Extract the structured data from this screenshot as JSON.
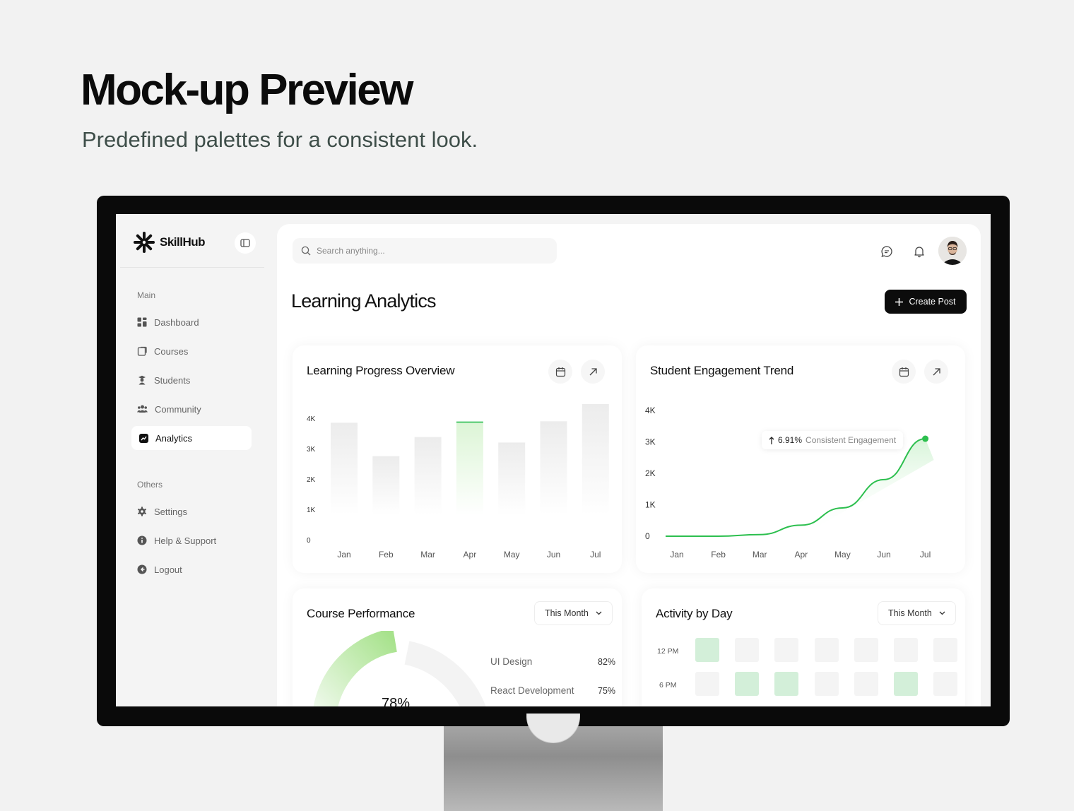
{
  "hero": {
    "title": "Mock-up Preview",
    "subtitle": "Predefined palettes for a consistent look."
  },
  "brand": {
    "name": "SkillHub"
  },
  "sidebar": {
    "main_label": "Main",
    "others_label": "Others",
    "main_items": [
      {
        "label": "Dashboard",
        "icon": "grid-icon"
      },
      {
        "label": "Courses",
        "icon": "book-icon"
      },
      {
        "label": "Students",
        "icon": "student-icon"
      },
      {
        "label": "Community",
        "icon": "users-icon"
      },
      {
        "label": "Analytics",
        "icon": "chart-icon",
        "active": true
      }
    ],
    "other_items": [
      {
        "label": "Settings",
        "icon": "gear-icon"
      },
      {
        "label": "Help & Support",
        "icon": "info-icon"
      },
      {
        "label": "Logout",
        "icon": "logout-icon"
      }
    ]
  },
  "search": {
    "placeholder": "Search anything..."
  },
  "page": {
    "title": "Learning Analytics",
    "create_label": "Create Post"
  },
  "progress_card": {
    "title": "Learning Progress Overview"
  },
  "engagement_card": {
    "title": "Student Engagement Trend",
    "badge_value": "6.91%",
    "badge_label": "Consistent Engagement"
  },
  "course_card": {
    "title": "Course Performance",
    "filter": "This Month",
    "gauge_value": "78%",
    "items": [
      {
        "label": "UI Design",
        "value": "82%"
      },
      {
        "label": "React Development",
        "value": "75%"
      }
    ]
  },
  "activity_card": {
    "title": "Activity by Day",
    "filter": "This Month",
    "rows": [
      {
        "label": "12 PM",
        "cells": [
          1,
          0,
          0,
          0,
          0,
          0,
          0
        ]
      },
      {
        "label": "6 PM",
        "cells": [
          0,
          1,
          1,
          0,
          0,
          1,
          0
        ]
      }
    ]
  },
  "colors": {
    "accent": "#22c55e",
    "accent_soft": "#d3efd9",
    "dark": "#0c0c0c"
  },
  "chart_data": [
    {
      "type": "bar",
      "categories": [
        "Jan",
        "Feb",
        "Mar",
        "Apr",
        "May",
        "Jun",
        "Jul"
      ],
      "values": [
        3850,
        2750,
        3380,
        3880,
        3200,
        3900,
        4500
      ],
      "highlight": "Apr",
      "ylim": [
        0,
        4000
      ],
      "yticks": [
        "0",
        "1K",
        "2K",
        "3K",
        "4K"
      ]
    },
    {
      "type": "line",
      "x": [
        "Jan",
        "Feb",
        "Mar",
        "Apr",
        "May",
        "Jun",
        "Jul"
      ],
      "values": [
        0,
        0,
        50,
        350,
        900,
        1800,
        3100
      ],
      "ylim": [
        0,
        4000
      ],
      "yticks": [
        "0",
        "1K",
        "2K",
        "3K",
        "4K"
      ]
    }
  ]
}
